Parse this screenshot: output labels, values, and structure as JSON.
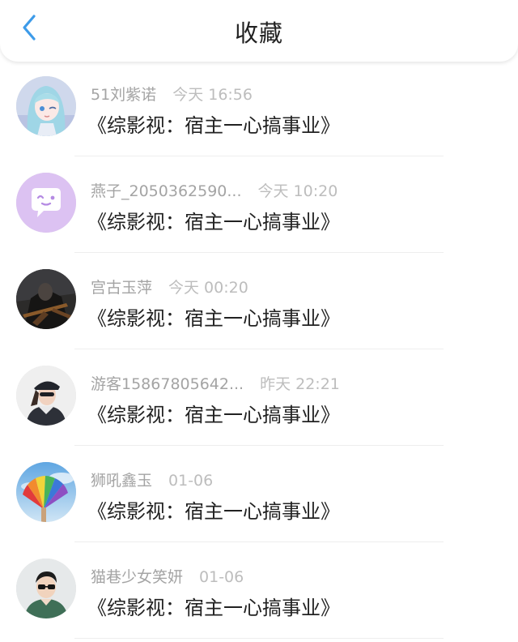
{
  "header": {
    "title": "收藏",
    "back_icon": "chevron-left-icon",
    "accent_color": "#3d9be9"
  },
  "favorites": [
    {
      "user": "51刘紫诺",
      "time": "今天 16:56",
      "title": "《综影视：宿主一心搞事业》",
      "avatar": "anime-girl-avatar"
    },
    {
      "user": "燕子_2050362590...",
      "time": "今天 10:20",
      "title": "《综影视：宿主一心搞事业》",
      "avatar": "chat-bubble-avatar"
    },
    {
      "user": "宫古玉萍",
      "time": "今天 00:20",
      "title": "《综影视：宿主一心搞事业》",
      "avatar": "dark-figure-avatar"
    },
    {
      "user": "游客15867805642...",
      "time": "昨天 22:21",
      "title": "《综影视：宿主一心搞事业》",
      "avatar": "person-cap-avatar"
    },
    {
      "user": "狮吼鑫玉",
      "time": "01-06",
      "title": "《综影视：宿主一心搞事业》",
      "avatar": "rainbow-fan-avatar"
    },
    {
      "user": "猫巷少女笑妍",
      "time": "01-06",
      "title": "《综影视：宿主一心搞事业》",
      "avatar": "person-sunglasses-avatar"
    }
  ]
}
